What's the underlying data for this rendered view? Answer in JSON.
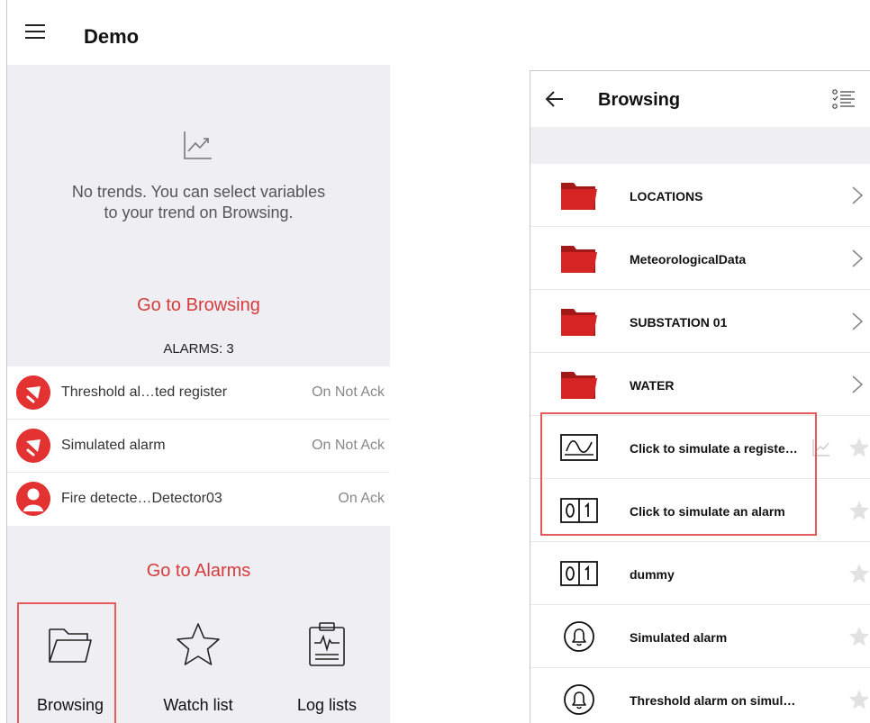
{
  "left": {
    "app_title": "Demo",
    "no_trends_line1": "No trends. You can select variables",
    "no_trends_line2": "to your trend on Browsing.",
    "go_browsing": "Go to Browsing",
    "alarms_count": "ALARMS: 3",
    "alarms": [
      {
        "name": "Threshold al…ted register",
        "status": "On Not Ack",
        "icon": "bell-slash-icon"
      },
      {
        "name": "Simulated alarm",
        "status": "On Not Ack",
        "icon": "bell-slash-icon"
      },
      {
        "name": "Fire detecte…Detector03",
        "status": "On Ack",
        "icon": "user-icon"
      }
    ],
    "go_alarms": "Go to Alarms",
    "nav": [
      {
        "label": "Browsing",
        "icon": "folder-icon"
      },
      {
        "label": "Watch list",
        "icon": "star-icon"
      },
      {
        "label": "Log lists",
        "icon": "clipboard-pulse-icon"
      }
    ]
  },
  "right": {
    "title": "Browsing",
    "items": [
      {
        "label": "LOCATIONS",
        "icon": "folder-icon"
      },
      {
        "label": "MeteorologicalData",
        "icon": "folder-icon"
      },
      {
        "label": "SUBSTATION 01",
        "icon": "folder-icon"
      },
      {
        "label": "WATER",
        "icon": "folder-icon"
      },
      {
        "label": "Click to simulate a registe…",
        "icon": "register-trend-icon"
      },
      {
        "label": "Click to simulate an alarm",
        "icon": "binary-01-icon"
      },
      {
        "label": "dummy",
        "icon": "binary-01-icon"
      },
      {
        "label": "Simulated alarm",
        "icon": "bell-circle-icon"
      },
      {
        "label": "Threshold alarm on simul…",
        "icon": "bell-circle-icon"
      }
    ]
  },
  "colors": {
    "accent_red": "#d63b3b",
    "alarm_red": "#e33232",
    "folder_red": "#d42424",
    "highlight": "#e55a5a",
    "gray_bg": "#efeff3"
  }
}
